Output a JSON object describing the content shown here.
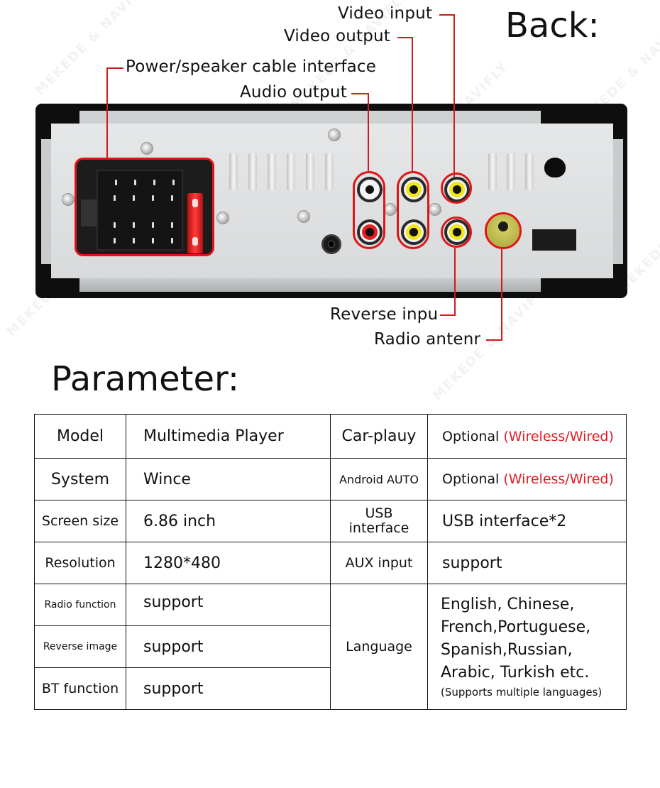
{
  "back_section": {
    "title": "Back:",
    "callouts": {
      "video_input": "Video input",
      "video_output": "Video output",
      "power_speaker": "Power/speaker cable interface",
      "audio_output": "Audio output",
      "reverse_input": "Reverse inpu",
      "radio_antenna": "Radio antenr"
    },
    "colors": {
      "callout_line": "#d11a1a",
      "highlight": "#e01616",
      "jack_white": "#f4f4f4",
      "jack_red": "#e42020",
      "jack_yellow": "#f2e51c",
      "antenna": "#c8c45a"
    }
  },
  "watermark": "MEKEDE & NAVIFLY",
  "parameter_section": {
    "title": "Parameter:",
    "rows": [
      {
        "left_key": "Model",
        "left_value": "Multimedia Player",
        "right_key": "Car-plauy",
        "right_value": "Optional",
        "right_value_note": "(Wireless/Wired)"
      },
      {
        "left_key": "System",
        "left_value": "Wince",
        "right_key": "Android AUTO",
        "right_value": "Optional",
        "right_value_note": "(Wireless/Wired)"
      },
      {
        "left_key": "Screen size",
        "left_value": "6.86 inch",
        "right_key": "USB interface",
        "right_value": "USB interface*2"
      },
      {
        "left_key": "Resolution",
        "left_value": "1280*480",
        "right_key": "AUX input",
        "right_value": "support"
      },
      {
        "left_key": "Radio function",
        "left_value": "support"
      },
      {
        "left_key": "Reverse image",
        "left_value": "support"
      },
      {
        "left_key": "BT function",
        "left_value": "support"
      }
    ],
    "language": {
      "key": "Language",
      "lines": [
        "English, Chinese,",
        "French,Portuguese,",
        "Spanish,Russian,",
        "Arabic, Turkish etc."
      ],
      "note": "(Supports multiple languages)"
    },
    "note_color": "#e01b24"
  }
}
